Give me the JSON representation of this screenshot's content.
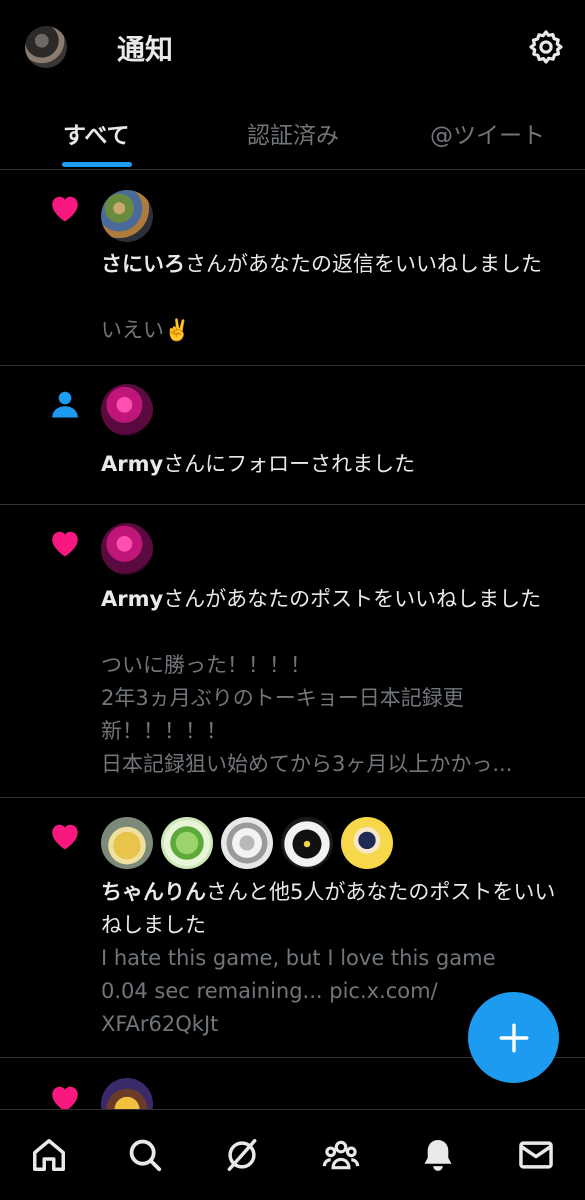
{
  "header": {
    "title": "通知"
  },
  "tabs": [
    {
      "label": "すべて",
      "active": true
    },
    {
      "label": "認証済み",
      "active": false
    },
    {
      "label": "@ツイート",
      "active": false
    }
  ],
  "notifications": [
    {
      "type": "like",
      "actor": "さにいろ",
      "message": "さんがあなたの返信をいいねしました",
      "snippet": [
        "いえい✌️"
      ]
    },
    {
      "type": "follow",
      "actor": "Army",
      "message": "さんにフォローされました",
      "snippet": []
    },
    {
      "type": "like",
      "actor": "Army",
      "message": "さんがあなたのポストをいいねしました",
      "snippet": [
        "ついに勝った！！！！",
        "2年3ヵ月ぶりのトーキョー日本記録更",
        "新！！！！！",
        "日本記録狙い始めてから3ヶ月以上かかっ..."
      ]
    },
    {
      "type": "like",
      "actor": "ちゃんりん",
      "message": "さんと他5人があなたのポストをいいねしました",
      "snippet": [
        "I hate this game, but I love this game",
        "0.04 sec remaining... pic.x.com/",
        "XFAr62QkJt"
      ]
    }
  ],
  "icons": {
    "like": "heart-icon",
    "follow": "person-icon",
    "settings": "gear-icon",
    "compose": "plus-icon",
    "nav": [
      "home-icon",
      "search-icon",
      "grok-icon",
      "communities-icon",
      "bell-icon",
      "mail-icon"
    ]
  },
  "colors": {
    "accent": "#1d9bf0",
    "like": "#f91880",
    "background": "#000000",
    "muted": "#71767b"
  }
}
